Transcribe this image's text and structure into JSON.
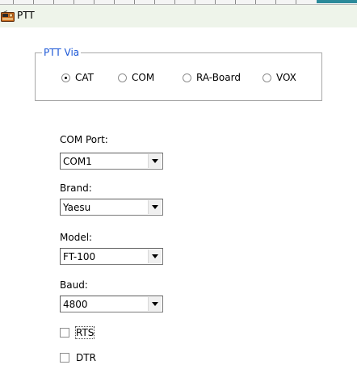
{
  "window": {
    "title": "PTT",
    "icon": "radio-icon"
  },
  "ptt_via": {
    "legend": "PTT Via",
    "options": [
      {
        "label": "CAT",
        "selected": true
      },
      {
        "label": "COM",
        "selected": false
      },
      {
        "label": "RA-Board",
        "selected": false
      },
      {
        "label": "VOX",
        "selected": false
      }
    ]
  },
  "fields": {
    "com_port": {
      "label": "COM Port:",
      "value": "COM1"
    },
    "brand": {
      "label": "Brand:",
      "value": "Yaesu"
    },
    "model": {
      "label": "Model:",
      "value": "FT-100"
    },
    "baud": {
      "label": "Baud:",
      "value": "4800"
    }
  },
  "checkboxes": {
    "rts": {
      "label": "RTS",
      "checked": false
    },
    "dtr": {
      "label": "DTR",
      "checked": false
    }
  },
  "colors": {
    "legend": "#1a56d6",
    "titlebar_bg": "#eef4ea",
    "ruler_accent": "#2b8a9a"
  }
}
